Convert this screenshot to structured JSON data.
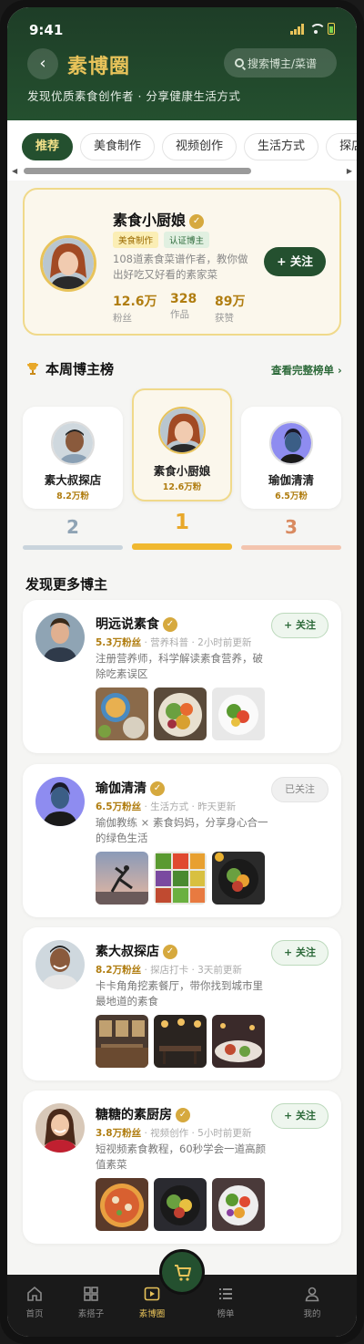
{
  "status": {
    "time": "9:41"
  },
  "header": {
    "back": "‹",
    "title": "素博圈",
    "search_placeholder": "搜索博主/菜谱",
    "subtitle": "发现优质素食创作者 · 分享健康生活方式"
  },
  "tabs": [
    "推荐",
    "美食制作",
    "视频创作",
    "生活方式",
    "探店打"
  ],
  "featured": {
    "name": "素食小厨娘",
    "badges": [
      "美食制作",
      "认证博主"
    ],
    "desc": "108道素食菜谱作者，教你做出好吃又好看的素家菜",
    "follow": "+ 关注",
    "stats": [
      {
        "value": "12.6万",
        "label": "粉丝"
      },
      {
        "value": "328",
        "label": "作品"
      },
      {
        "value": "89万",
        "label": "获赞"
      }
    ]
  },
  "ranking": {
    "title": "本周博主榜",
    "link": "查看完整榜单 ›",
    "items": [
      {
        "rank": "2",
        "name": "素大叔探店",
        "fans": "8.2万粉"
      },
      {
        "rank": "1",
        "name": "素食小厨娘",
        "fans": "12.6万粉"
      },
      {
        "rank": "3",
        "name": "瑜伽清清",
        "fans": "6.5万粉"
      }
    ]
  },
  "discover": {
    "title": "发现更多博主",
    "creators": [
      {
        "name": "明远说素食",
        "fans": "5.3万粉丝",
        "category": "营养科普",
        "updated": "2小时前更新",
        "desc": "注册营养师，科学解读素食营养，破除吃素误区",
        "follow": "+ 关注",
        "followed": false
      },
      {
        "name": "瑜伽清清",
        "fans": "6.5万粉丝",
        "category": "生活方式",
        "updated": "昨天更新",
        "desc": "瑜伽教练 × 素食妈妈，分享身心合一的绿色生活",
        "follow": "已关注",
        "followed": true
      },
      {
        "name": "素大叔探店",
        "fans": "8.2万粉丝",
        "category": "探店打卡",
        "updated": "3天前更新",
        "desc": "卡卡角角挖素餐厅，带你找到城市里最地道的素食",
        "follow": "+ 关注",
        "followed": false
      },
      {
        "name": "糖糖的素厨房",
        "fans": "3.8万粉丝",
        "category": "视频创作",
        "updated": "5小时前更新",
        "desc": "短视频素食教程，60秒学会一道高颜值素菜",
        "follow": "+ 关注",
        "followed": false
      }
    ]
  },
  "nav": {
    "items": [
      {
        "label": "首页",
        "icon": "home-icon"
      },
      {
        "label": "素搭子",
        "icon": "grid-icon"
      },
      {
        "label": "素博圈",
        "icon": "play-icon"
      },
      {
        "label": "榜单",
        "icon": "list-icon"
      },
      {
        "label": "我的",
        "icon": "user-icon"
      }
    ],
    "cart_icon": "cart-icon"
  },
  "colors": {
    "brand_green": "#24502f",
    "accent_gold": "#e8c35a"
  }
}
